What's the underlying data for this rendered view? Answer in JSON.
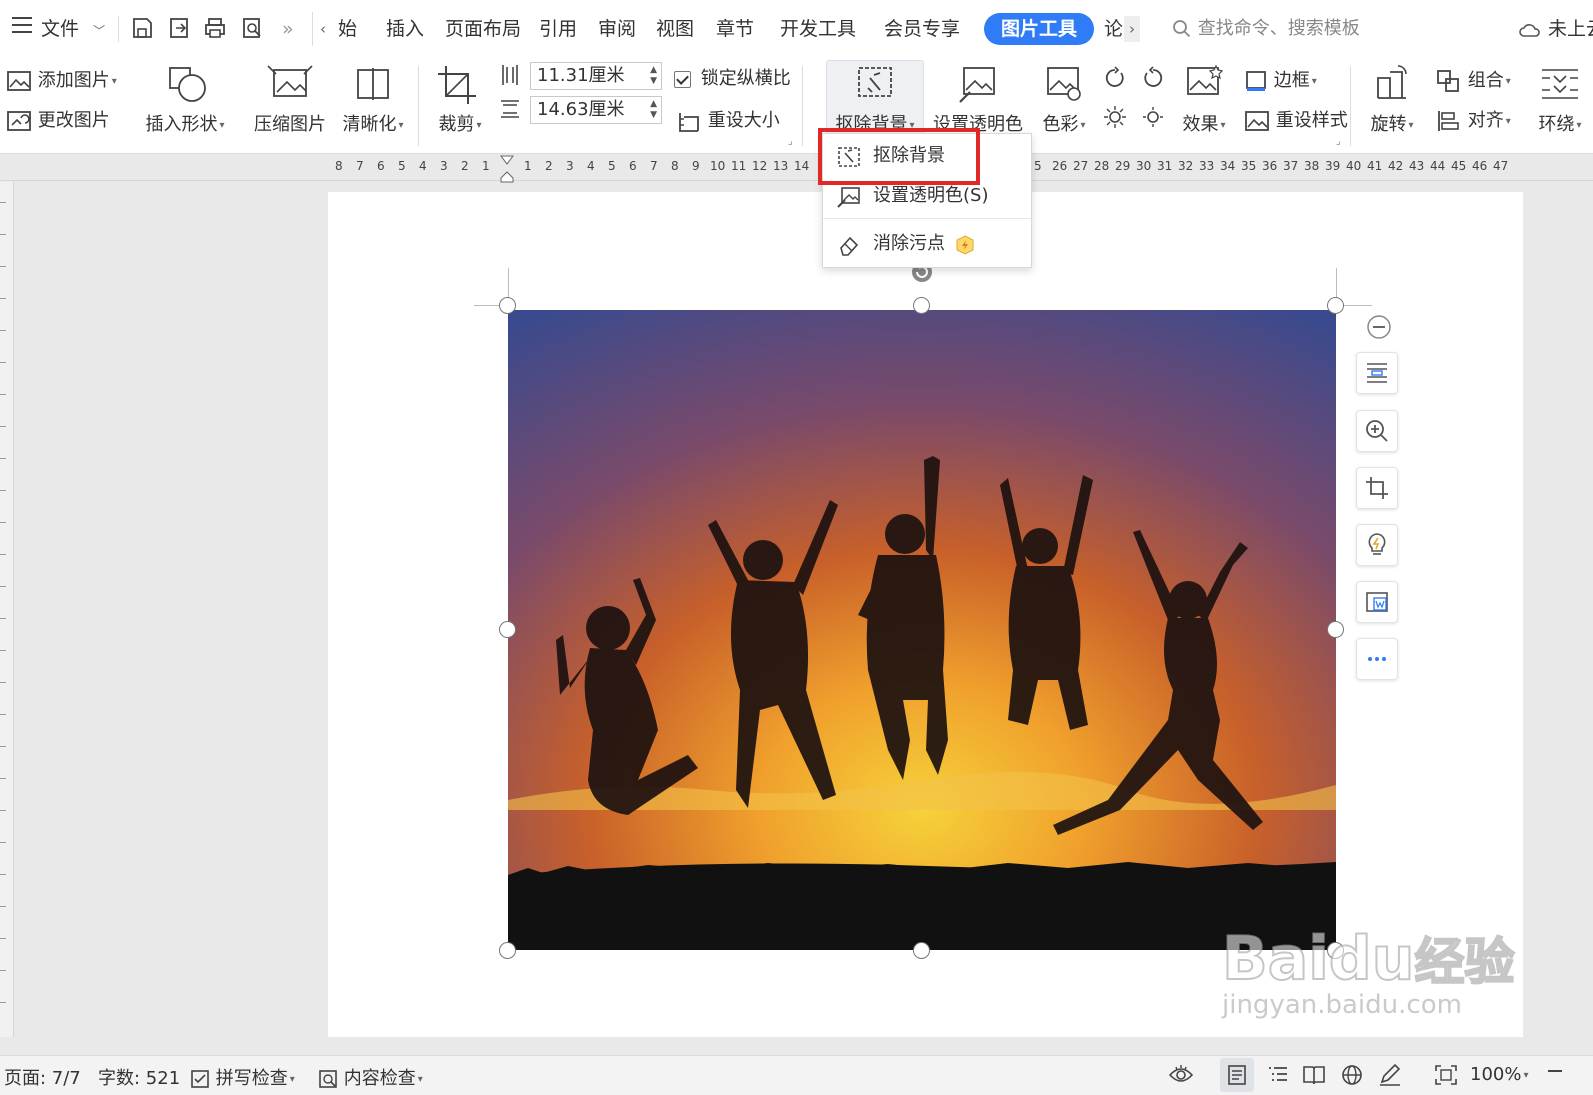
{
  "menubar": {
    "file_label": "文件",
    "tabs": [
      "始",
      "插入",
      "页面布局",
      "引用",
      "审阅",
      "视图",
      "章节",
      "开发工具",
      "会员专享"
    ],
    "active_tab": "图片工具",
    "tab_after": "论",
    "search_placeholder": "查找命令、搜索模板",
    "cloud_label": "未上云"
  },
  "ribbon": {
    "add_picture": "添加图片",
    "change_picture": "更改图片",
    "insert_shape": "插入形状",
    "compress_picture": "压缩图片",
    "sharpen": "清晰化",
    "crop": "裁剪",
    "width_value": "11.31厘米",
    "height_value": "14.63厘米",
    "lock_ratio": "锁定纵横比",
    "reset_size": "重设大小",
    "remove_background": "抠除背景",
    "set_transparent": "设置透明色",
    "color": "色彩",
    "effects": "效果",
    "border": "边框",
    "reset_style": "重设样式",
    "rotate": "旋转",
    "group": "组合",
    "align": "对齐",
    "wrap": "环绕"
  },
  "ruler": {
    "left_numbers": [
      "8",
      "7",
      "6",
      "5",
      "4",
      "3",
      "2",
      "1"
    ],
    "right_numbers": [
      "1",
      "2",
      "3",
      "4",
      "5",
      "6",
      "7",
      "8",
      "9",
      "10",
      "11",
      "12",
      "13",
      "14"
    ],
    "far_numbers": [
      "5",
      "26",
      "27",
      "28",
      "29",
      "30",
      "31",
      "32",
      "33",
      "34",
      "35",
      "36",
      "37",
      "38",
      "39",
      "40",
      "41",
      "42",
      "43",
      "44",
      "45",
      "46",
      "47"
    ]
  },
  "dropdown": {
    "items": [
      {
        "label": "抠除背景"
      },
      {
        "label": "设置透明色(S)"
      },
      {
        "label": "消除污点"
      }
    ]
  },
  "statusbar": {
    "page": "页面: 7/7",
    "word_count": "字数: 521",
    "spell_check": "拼写检查",
    "content_check": "内容检查",
    "zoom": "100%"
  },
  "watermark": {
    "brand": "Bai",
    "brand2": "du",
    "cn": "经验",
    "url": "jingyan.baidu.com"
  },
  "colors": {
    "accent": "#2f7cf6",
    "highlight_box": "#e02828",
    "sky_top": "#3a4a8e",
    "sunset_orange": "#e8802a",
    "sun_yellow": "#f6d23a"
  }
}
